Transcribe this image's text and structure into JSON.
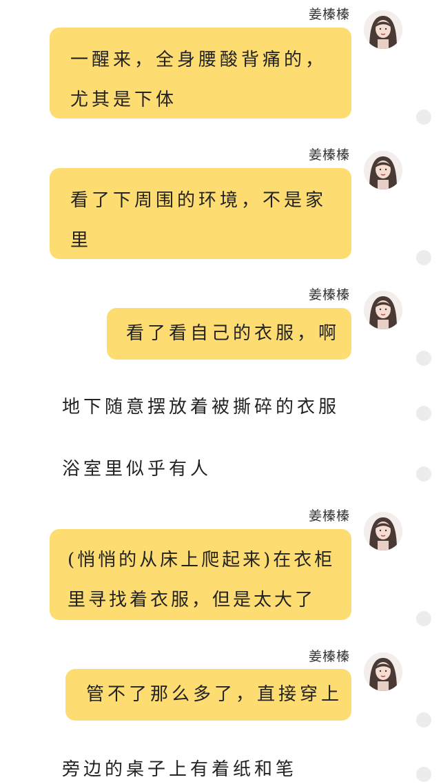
{
  "messages": [
    {
      "sender": "姜榛榛",
      "lines": [
        "一醒来，全身腰酸背痛的，",
        "尤其是下体"
      ]
    },
    {
      "sender": "姜榛榛",
      "lines": [
        "看了下周围的环境，不是家",
        "里"
      ]
    },
    {
      "sender": "姜榛榛",
      "lines": [
        "看了看自己的衣服，啊"
      ]
    },
    {
      "narration": "地下随意摆放着被撕碎的衣服"
    },
    {
      "narration": "浴室里似乎有人"
    },
    {
      "sender": "姜榛榛",
      "lines": [
        "(悄悄的从床上爬起来)在衣柜",
        "里寻找着衣服，但是太大了"
      ]
    },
    {
      "sender": "姜榛榛",
      "lines": [
        "管不了那么多了，直接穿上"
      ]
    },
    {
      "narration": "旁边的桌子上有着纸和笔"
    }
  ],
  "colors": {
    "bubble": "#fddd72",
    "dot": "#ececec"
  },
  "icons": {
    "avatar": "avatar",
    "side_dot": "circle"
  }
}
